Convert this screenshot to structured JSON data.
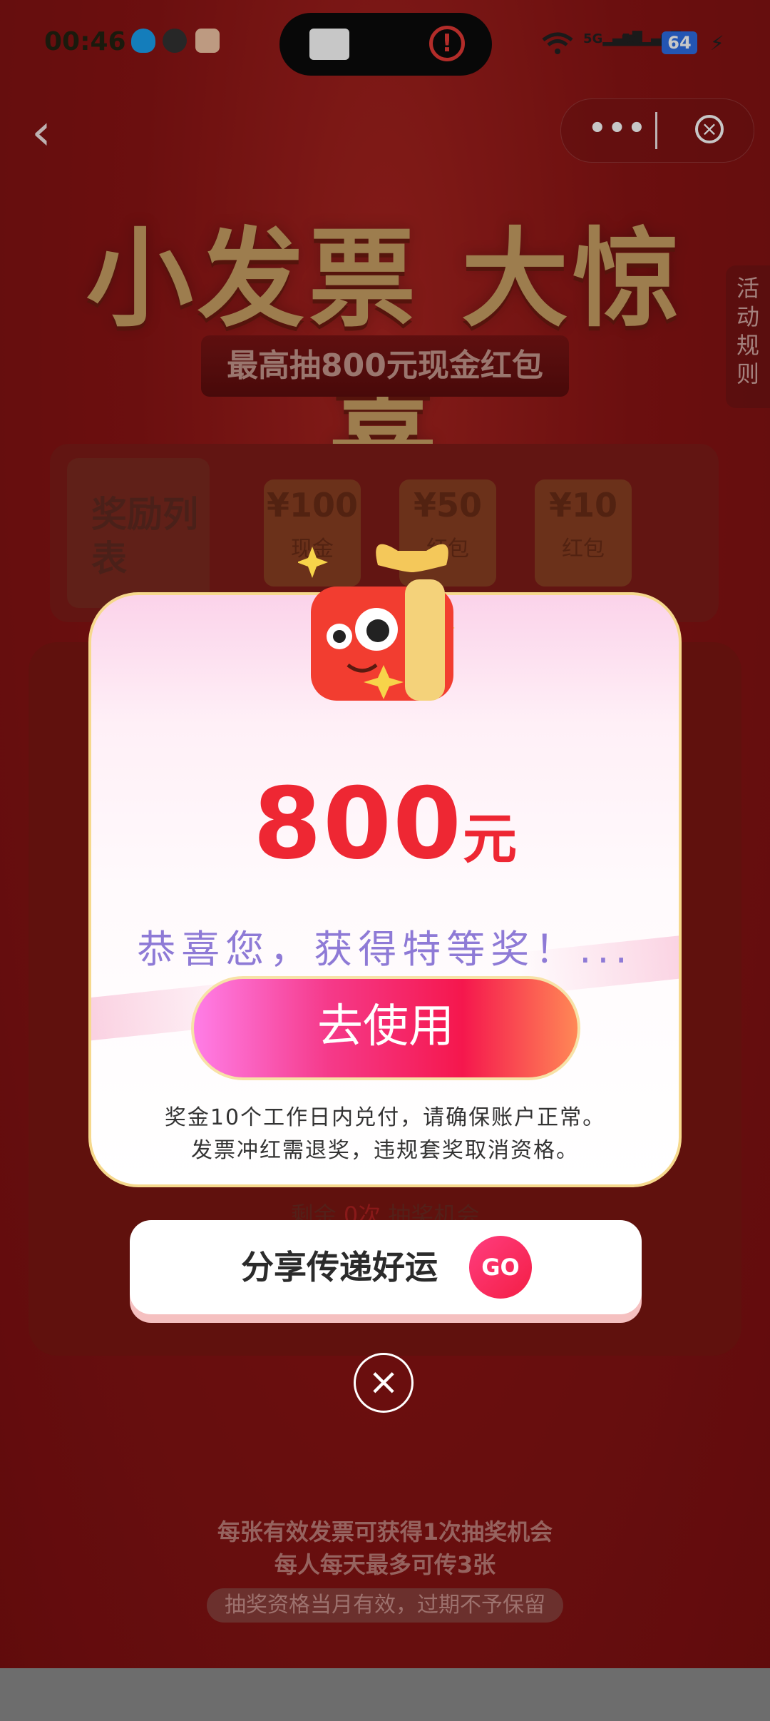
{
  "status_bar": {
    "time": "00:46",
    "signal1": "5G",
    "signal2": "5G",
    "battery": "64",
    "bolt": "⚡"
  },
  "nav": {
    "back_glyph": "‹",
    "more_glyph": "•••",
    "close_glyph": "×"
  },
  "banner": {
    "title": "小发票 大惊喜",
    "subtitle": "最高抽800元现金红包"
  },
  "side": {
    "rules_label": "活动规则"
  },
  "reward_list": {
    "title": "奖励列表",
    "prizes": [
      {
        "amount": "¥100",
        "label": "现金"
      },
      {
        "amount": "¥50",
        "label": "红包"
      },
      {
        "amount": "¥10",
        "label": "红包"
      }
    ]
  },
  "machine": {
    "remain_prefix": "剩余",
    "remain_count": "0次",
    "remain_suffix": "抽奖机会"
  },
  "footer": {
    "line1": "每张有效发票可获得1次抽奖机会",
    "line2": "每人每天最多可传3张",
    "pill": "抽奖资格当月有效，过期不予保留"
  },
  "modal": {
    "amount": "800",
    "unit": "元",
    "congrats": "恭喜您，获得特等奖！...",
    "use_button": "去使用",
    "note_line1": "奖金10个工作日内兑付，请确保账户正常。",
    "note_line2": "发票冲红需退奖，违规套奖取消资格。"
  },
  "share": {
    "label": "分享传递好运",
    "go": "GO"
  },
  "colors": {
    "accent_red": "#ee2733",
    "congrats_purple": "#8e7ad6",
    "bg_red": "#8c1313"
  }
}
